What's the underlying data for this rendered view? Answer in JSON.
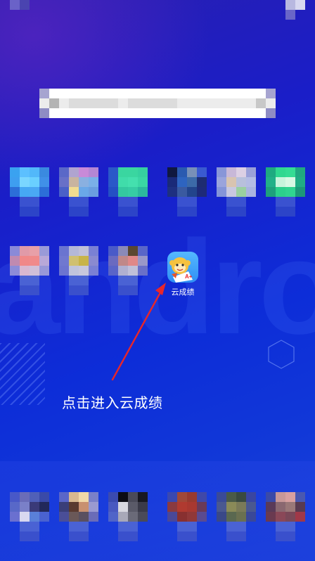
{
  "highlighted_app": {
    "label": "云成绩",
    "icon": "monkey-mascot-icon",
    "icon_color": "#3a9cf7",
    "badge_text": "A+"
  },
  "caption": "点击进入云成绩",
  "colors": {
    "wallpaper_top": "#2a1fb0",
    "wallpaper_bottom": "#1a44dc",
    "arrow": "#e8262a",
    "search_bar": "#ffffff"
  },
  "wallpaper_watermark": "android",
  "pixelated_rows": {
    "row1": [
      "app-1",
      "app-2",
      "app-3",
      "app-4",
      "app-5",
      "app-6"
    ],
    "row2": [
      "app-7",
      "app-8",
      "app-9"
    ],
    "dock": [
      "dock-app-1",
      "dock-app-2",
      "dock-app-3",
      "dock-app-4",
      "dock-app-5",
      "dock-app-6"
    ]
  }
}
